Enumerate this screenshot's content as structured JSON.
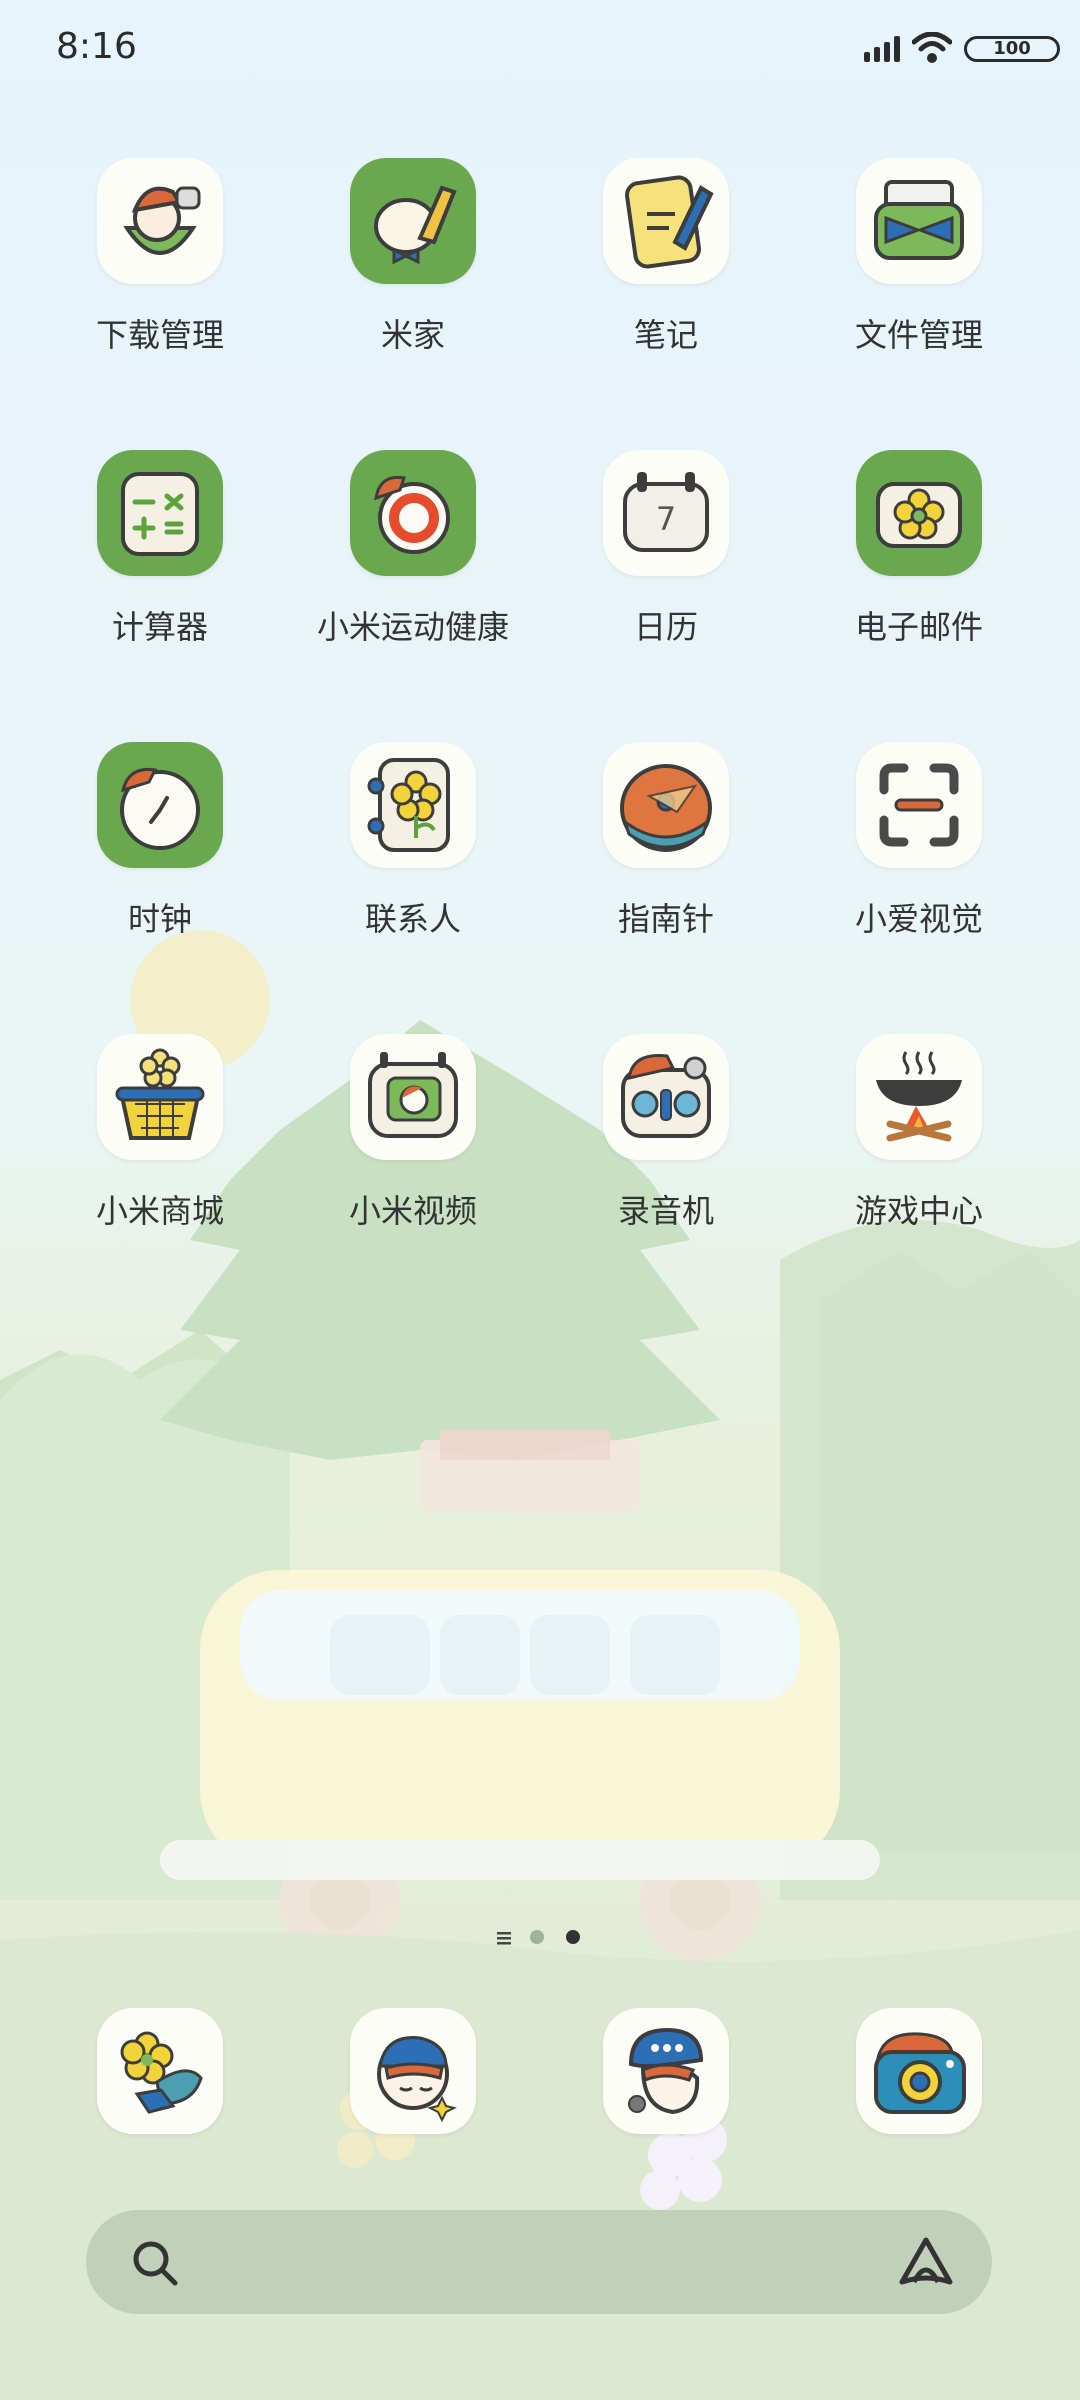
{
  "status_bar": {
    "time": "8:16",
    "battery": "100",
    "icons": [
      "signal-icon",
      "wifi-icon",
      "battery-icon"
    ]
  },
  "apps": [
    {
      "label": "下载管理",
      "icon": "download-manager-icon"
    },
    {
      "label": "米家",
      "icon": "mi-home-icon"
    },
    {
      "label": "笔记",
      "icon": "notes-icon"
    },
    {
      "label": "文件管理",
      "icon": "file-manager-icon"
    },
    {
      "label": "计算器",
      "icon": "calculator-icon"
    },
    {
      "label": "小米运动健康",
      "icon": "mi-fitness-icon"
    },
    {
      "label": "日历",
      "icon": "calendar-icon"
    },
    {
      "label": "电子邮件",
      "icon": "email-icon"
    },
    {
      "label": "时钟",
      "icon": "clock-icon"
    },
    {
      "label": "联系人",
      "icon": "contacts-icon"
    },
    {
      "label": "指南针",
      "icon": "compass-icon"
    },
    {
      "label": "小爱视觉",
      "icon": "xiaoai-vision-icon"
    },
    {
      "label": "小米商城",
      "icon": "mi-store-icon"
    },
    {
      "label": "小米视频",
      "icon": "mi-video-icon"
    },
    {
      "label": "录音机",
      "icon": "recorder-icon"
    },
    {
      "label": "游戏中心",
      "icon": "game-center-icon"
    }
  ],
  "page_indicator": {
    "pages": 3,
    "current": 3
  },
  "dock": [
    {
      "icon": "themes-icon"
    },
    {
      "icon": "browser-icon"
    },
    {
      "icon": "messages-icon"
    },
    {
      "icon": "camera-icon"
    }
  ],
  "search_bar": {
    "icon": "search-icon",
    "assistant_icon": "xiaoai-assistant-icon"
  },
  "colors": {
    "icon_green": "#6aa84f",
    "tile_white": "#fdfdf8",
    "label": "#333333"
  }
}
